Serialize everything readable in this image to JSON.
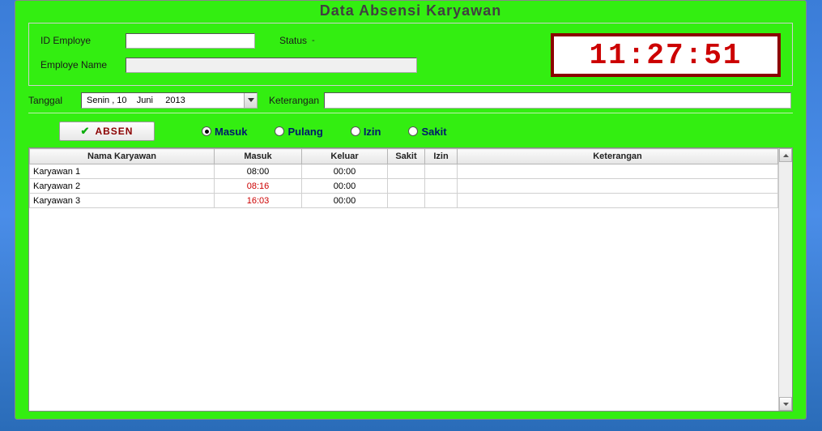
{
  "title": "Data Absensi Karyawan",
  "fields": {
    "id_label": "ID Employe",
    "id_value": "",
    "name_label": "Employe Name",
    "name_value": "",
    "status_label": "Status",
    "status_value": "-"
  },
  "clock": "11:27:51",
  "date": {
    "label": "Tanggal",
    "value": "Senin , 10    Juni     2013"
  },
  "keterangan": {
    "label": "Keterangan",
    "value": ""
  },
  "absen_button": "ABSEN",
  "radios": {
    "masuk": "Masuk",
    "pulang": "Pulang",
    "izin": "Izin",
    "sakit": "Sakit",
    "selected": "masuk"
  },
  "table": {
    "headers": {
      "nama": "Nama Karyawan",
      "masuk": "Masuk",
      "keluar": "Keluar",
      "sakit": "Sakit",
      "izin": "Izin",
      "keterangan": "Keterangan"
    },
    "rows": [
      {
        "nama": "Karyawan 1",
        "masuk": "08:00",
        "keluar": "00:00",
        "sakit": "",
        "izin": "",
        "keterangan": "",
        "late": false
      },
      {
        "nama": "Karyawan 2",
        "masuk": "08:16",
        "keluar": "00:00",
        "sakit": "",
        "izin": "",
        "keterangan": "",
        "late": true
      },
      {
        "nama": "Karyawan 3",
        "masuk": "16:03",
        "keluar": "00:00",
        "sakit": "",
        "izin": "",
        "keterangan": "",
        "late": true
      }
    ]
  }
}
